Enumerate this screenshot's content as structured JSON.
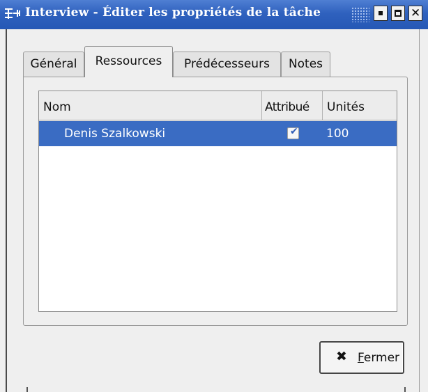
{
  "window": {
    "title": "Interview - Éditer les propriétés de la tâche",
    "controls": [
      "minimize-icon",
      "maximize-icon",
      "close-icon"
    ]
  },
  "tabs": [
    {
      "label": "Général",
      "active": false
    },
    {
      "label": "Ressources",
      "active": true
    },
    {
      "label": "Prédécesseurs",
      "active": false
    },
    {
      "label": "Notes",
      "active": false
    }
  ],
  "resources_table": {
    "columns": [
      "Nom",
      "Attribué",
      "Unités"
    ],
    "rows": [
      {
        "name": "Denis Szalkowski",
        "assigned": true,
        "units": "100",
        "selected": true
      }
    ]
  },
  "close_button": {
    "icon": "close-x-icon",
    "mnemonic": "F",
    "label_rest": "ermer"
  },
  "colors": {
    "titlebar": "#2f61be",
    "selection": "#3a6cc3",
    "window_bg": "#efefef"
  }
}
